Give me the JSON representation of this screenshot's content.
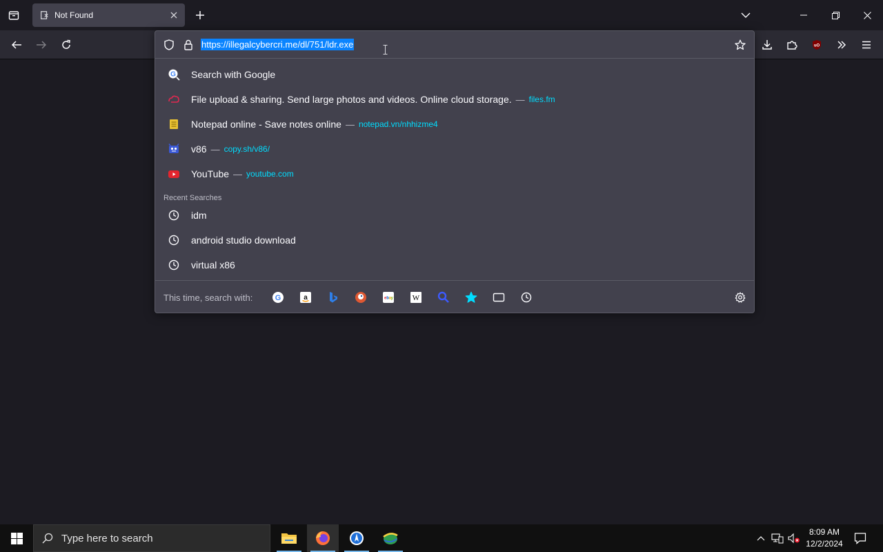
{
  "browser": {
    "tab": {
      "title": "Not Found",
      "icon": "page-error-icon"
    },
    "new_tab_symbol": "+",
    "urlbar": {
      "url": "https://illegalcybercri.me/dl/751/ldr.exe",
      "selected": true
    }
  },
  "popup": {
    "results": [
      {
        "title": "Search with Google",
        "url": "",
        "icon": "google-search-icon"
      },
      {
        "title": "File upload & sharing. Send large photos and videos. Online cloud storage.",
        "url": "files.fm",
        "icon": "filesfm-icon"
      },
      {
        "title": "Notepad online - Save notes online",
        "url": "notepad.vn/nhhizme4",
        "icon": "notepad-icon"
      },
      {
        "title": "v86",
        "url": "copy.sh/v86/",
        "icon": "v86-icon"
      },
      {
        "title": "YouTube",
        "url": "youtube.com",
        "icon": "youtube-icon"
      }
    ],
    "separator": "—",
    "recent_label": "Recent Searches",
    "recent_searches": [
      "idm",
      "android studio download",
      "virtual x86"
    ],
    "oneoff_label": "This time, search with:",
    "engines": [
      "google",
      "amazon",
      "bing",
      "duckduckgo",
      "ebay",
      "wikipedia",
      "search",
      "bookmarks",
      "tabs",
      "history"
    ]
  },
  "taskbar": {
    "search_placeholder": "Type here to search",
    "time": "8:09 AM",
    "date": "12/2/2024"
  },
  "colors": {
    "accent": "#0a84ff",
    "url_link": "#00ddff",
    "popup_bg": "#42414d",
    "toolbar_bg": "#2b2a33",
    "page_bg": "#1c1b22"
  }
}
